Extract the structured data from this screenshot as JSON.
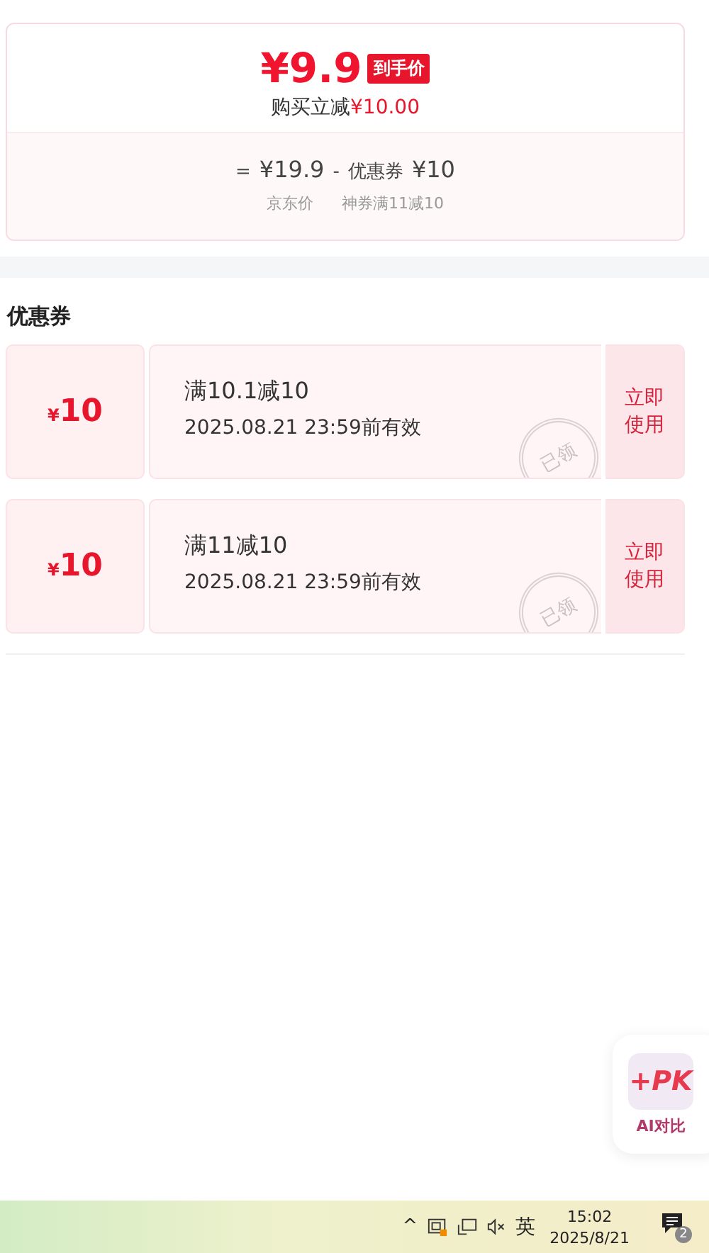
{
  "price_card": {
    "final_price": "¥9.9",
    "final_badge": "到手价",
    "saving_label": "购买立减",
    "saving_amount": "¥10.00",
    "formula": [
      {
        "kind": "op",
        "text": "="
      },
      {
        "kind": "amount",
        "text": "¥19.9"
      },
      {
        "kind": "op",
        "text": "-"
      },
      {
        "kind": "label",
        "text": "优惠券"
      },
      {
        "kind": "amount",
        "text": "¥10"
      }
    ],
    "captions": [
      "京东价",
      "神券满11减10"
    ]
  },
  "coupons_section": {
    "title": "优惠券",
    "coupons": [
      {
        "amount_symbol": "¥",
        "amount": "10",
        "condition": "满10.1减10",
        "validity": "2025.08.21 23:59前有效",
        "stamp": "已领",
        "action": "立即使用"
      },
      {
        "amount_symbol": "¥",
        "amount": "10",
        "condition": "满11减10",
        "validity": "2025.08.21 23:59前有效",
        "stamp": "已领",
        "action": "立即使用"
      }
    ]
  },
  "floating_button": {
    "icon_text": "+PK",
    "label": "AI对比"
  },
  "taskbar": {
    "tray_chevron": "^",
    "input_method": "英",
    "time": "15:02",
    "date": "2025/8/21",
    "notification_count": "2"
  }
}
